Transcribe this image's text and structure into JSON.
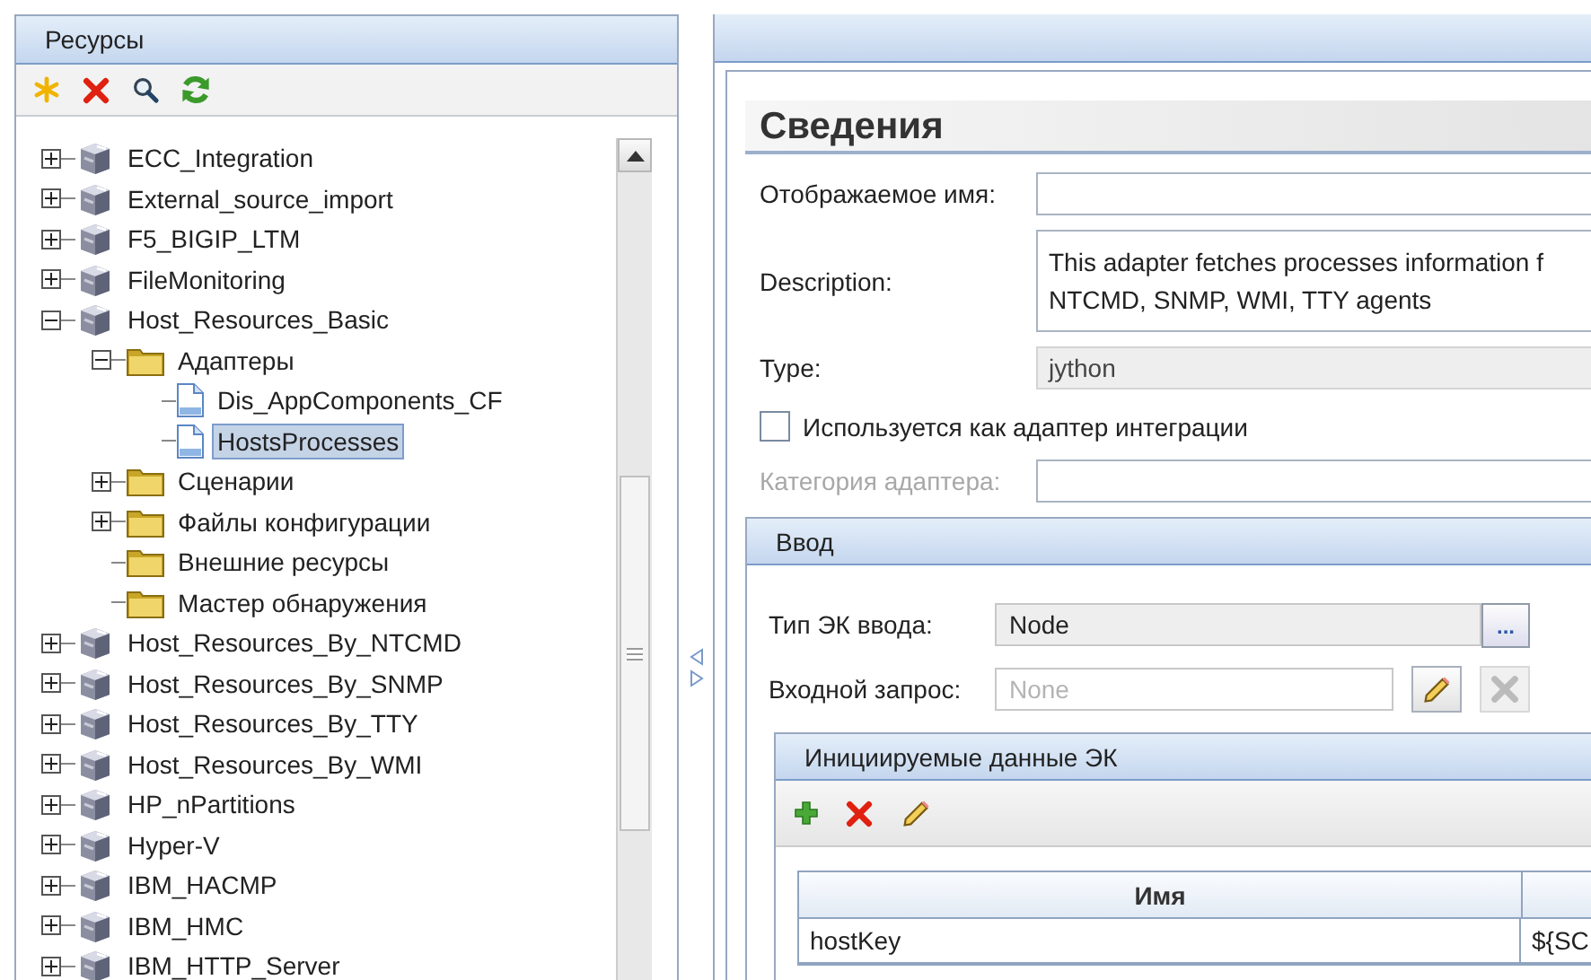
{
  "resources_panel": {
    "title": "Ресурсы",
    "toolbar": [
      {
        "kind": "new"
      },
      {
        "kind": "delete"
      },
      {
        "kind": "search"
      },
      {
        "kind": "refresh"
      }
    ],
    "tree": [
      {
        "label": "ECC_Integration",
        "kind": "package",
        "expanded": false,
        "selected": false
      },
      {
        "label": "External_source_import",
        "kind": "package",
        "expanded": false,
        "selected": false
      },
      {
        "label": "F5_BIGIP_LTM",
        "kind": "package",
        "expanded": false,
        "selected": false
      },
      {
        "label": "FileMonitoring",
        "kind": "package",
        "expanded": false,
        "selected": false
      },
      {
        "label": "Host_Resources_Basic",
        "kind": "package",
        "expanded": true,
        "selected": false,
        "children": [
          {
            "label": "Адаптеры",
            "kind": "folder",
            "expanded": true,
            "selected": false,
            "children": [
              {
                "label": "Dis_AppComponents_CF",
                "kind": "file",
                "selected": false
              },
              {
                "label": "HostsProcesses",
                "kind": "file",
                "selected": true
              }
            ]
          },
          {
            "label": "Сценарии",
            "kind": "folder",
            "expanded": false,
            "selected": false
          },
          {
            "label": "Файлы конфигурации",
            "kind": "folder",
            "expanded": false,
            "selected": false
          },
          {
            "label": "Внешние ресурсы",
            "kind": "folder",
            "selected": false
          },
          {
            "label": "Мастер обнаружения",
            "kind": "folder",
            "selected": false
          }
        ]
      },
      {
        "label": "Host_Resources_By_NTCMD",
        "kind": "package",
        "expanded": false,
        "selected": false
      },
      {
        "label": "Host_Resources_By_SNMP",
        "kind": "package",
        "expanded": false,
        "selected": false
      },
      {
        "label": "Host_Resources_By_TTY",
        "kind": "package",
        "expanded": false,
        "selected": false
      },
      {
        "label": "Host_Resources_By_WMI",
        "kind": "package",
        "expanded": false,
        "selected": false
      },
      {
        "label": "HP_nPartitions",
        "kind": "package",
        "expanded": false,
        "selected": false
      },
      {
        "label": "Hyper-V",
        "kind": "package",
        "expanded": false,
        "selected": false
      },
      {
        "label": "IBM_HACMP",
        "kind": "package",
        "expanded": false,
        "selected": false
      },
      {
        "label": "IBM_HMC",
        "kind": "package",
        "expanded": false,
        "selected": false
      },
      {
        "label": "IBM_HTTP_Server",
        "kind": "package",
        "expanded": false,
        "selected": false
      }
    ]
  },
  "details": {
    "heading": "Сведения",
    "display_name": {
      "label": "Отображаемое имя:"
    },
    "description": {
      "label": "Description:",
      "lines": [
        "This adapter fetches processes information f",
        "NTCMD, SNMP, WMI, TTY agents"
      ]
    },
    "type": {
      "label": "Type:",
      "value": "jython",
      "disabled": true
    },
    "integration_checkbox": {
      "label": "Используется как адаптер интеграции",
      "checked": false
    },
    "adapter_category": {
      "label": "Категория адаптера:",
      "disabled": true
    },
    "input_section": {
      "title": "Ввод",
      "input_ci_type": {
        "label": "Тип ЭК ввода:",
        "value": "Node",
        "button": "..."
      },
      "input_query": {
        "label": "Входной запрос:",
        "placeholder": "None",
        "clear_disabled": true
      },
      "triggered_data": {
        "title": "Инициируемые данные ЭК",
        "toolbar": [
          {
            "kind": "add"
          },
          {
            "kind": "delete"
          },
          {
            "kind": "edit"
          }
        ],
        "table": {
          "columns": [
            "Имя"
          ],
          "rows": [
            [
              "hostKey",
              "${SC"
            ]
          ]
        }
      }
    }
  }
}
